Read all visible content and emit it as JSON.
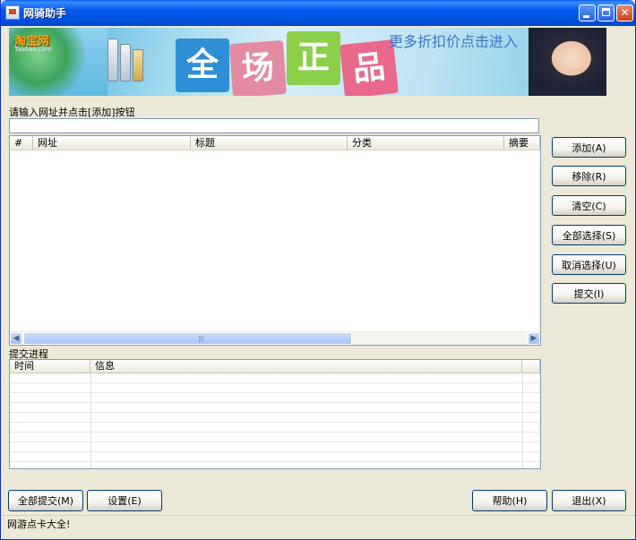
{
  "window": {
    "title": "网骑助手"
  },
  "titlebar": {
    "close_glyph": "✕"
  },
  "banner": {
    "brand": "淘宝网",
    "brand_sub": "Taobao.com",
    "tiles": [
      "全",
      "场",
      "正",
      "品"
    ],
    "tile_colors": [
      "#2f8fd6",
      "#e48aa3",
      "#8ccf4b",
      "#e9688c"
    ],
    "promo": "更多折扣价点击进入"
  },
  "url_section": {
    "label": "请输入网址并点击[添加]按钮",
    "input_value": "",
    "input_placeholder": ""
  },
  "listview": {
    "columns": [
      "#",
      "网址",
      "标题",
      "分类",
      "摘要"
    ],
    "rows": []
  },
  "side_buttons": {
    "add": "添加(A)",
    "remove": "移除(R)",
    "clear": "清空(C)",
    "select_all": "全部选择(S)",
    "deselect": "取消选择(U)",
    "submit": "提交(I)"
  },
  "progress": {
    "label": "提交进程",
    "columns": [
      "时间",
      "信息"
    ]
  },
  "bottom_buttons": {
    "submit_all": "全部提交(M)",
    "settings": "设置(E)",
    "help": "帮助(H)",
    "exit": "退出(X)"
  },
  "status": {
    "text": "网游点卡大全!"
  }
}
